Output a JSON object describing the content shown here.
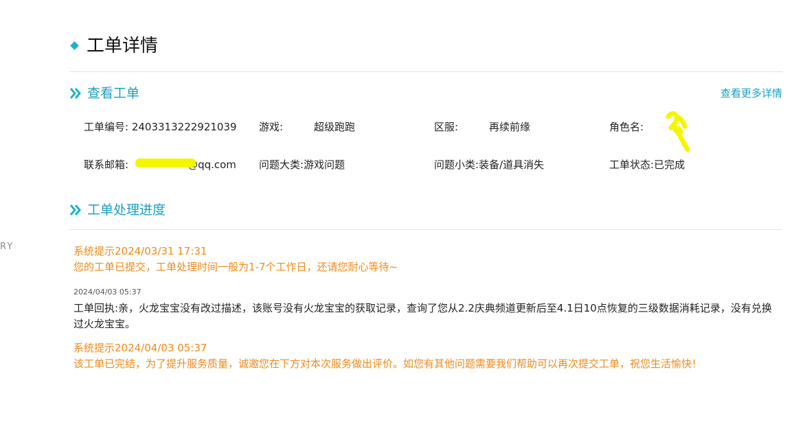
{
  "side_fragment": "RY",
  "page": {
    "title": "工单详情"
  },
  "view_section": {
    "title": "查看工单",
    "more_link": "查看更多详情",
    "row1": {
      "ticket_no_label": "工单编号:",
      "ticket_no_value": "2403313222921039",
      "game_label": "游戏:",
      "game_value": "超级跑跑",
      "server_label": "区服:",
      "server_value": "再续前缘",
      "role_label": "角色名:",
      "role_value": ""
    },
    "row2": {
      "email_label": "联系邮箱:",
      "email_value": "@qq.com",
      "category_label": "问题大类:",
      "category_value": "游戏问题",
      "subcategory_label": "问题小类:",
      "subcategory_value": "装备/道具消失",
      "status_label": "工单状态:",
      "status_value": "已完成"
    }
  },
  "progress_section": {
    "title": "工单处理进度",
    "entries": [
      {
        "header": "系统提示2024/03/31 17:31",
        "text": "您的工单已提交，工单处理时间一般为1-7个工作日，还请您耐心等待~"
      },
      {
        "time": "2024/04/03 05:37",
        "text": "工单回执:亲，火龙宝宝没有改过描述，该账号没有火龙宝宝的获取记录，查询了您从2.2庆典频道更新后至4.1日10点恢复的三级数据消耗记录，没有兑换过火龙宝宝。"
      },
      {
        "header": "系统提示2024/04/03 05:37",
        "text": "该工单已完结，为了提升服务质量，诚邀您在下方对本次服务做出评价。如您有其他问题需要我们帮助可以再次提交工单，祝您生活愉快！"
      }
    ]
  },
  "colors": {
    "accent": "#1a9fc0",
    "diamond": "#1ab3c9",
    "system_text": "#ee8a1a",
    "redaction": "#f5f500"
  }
}
